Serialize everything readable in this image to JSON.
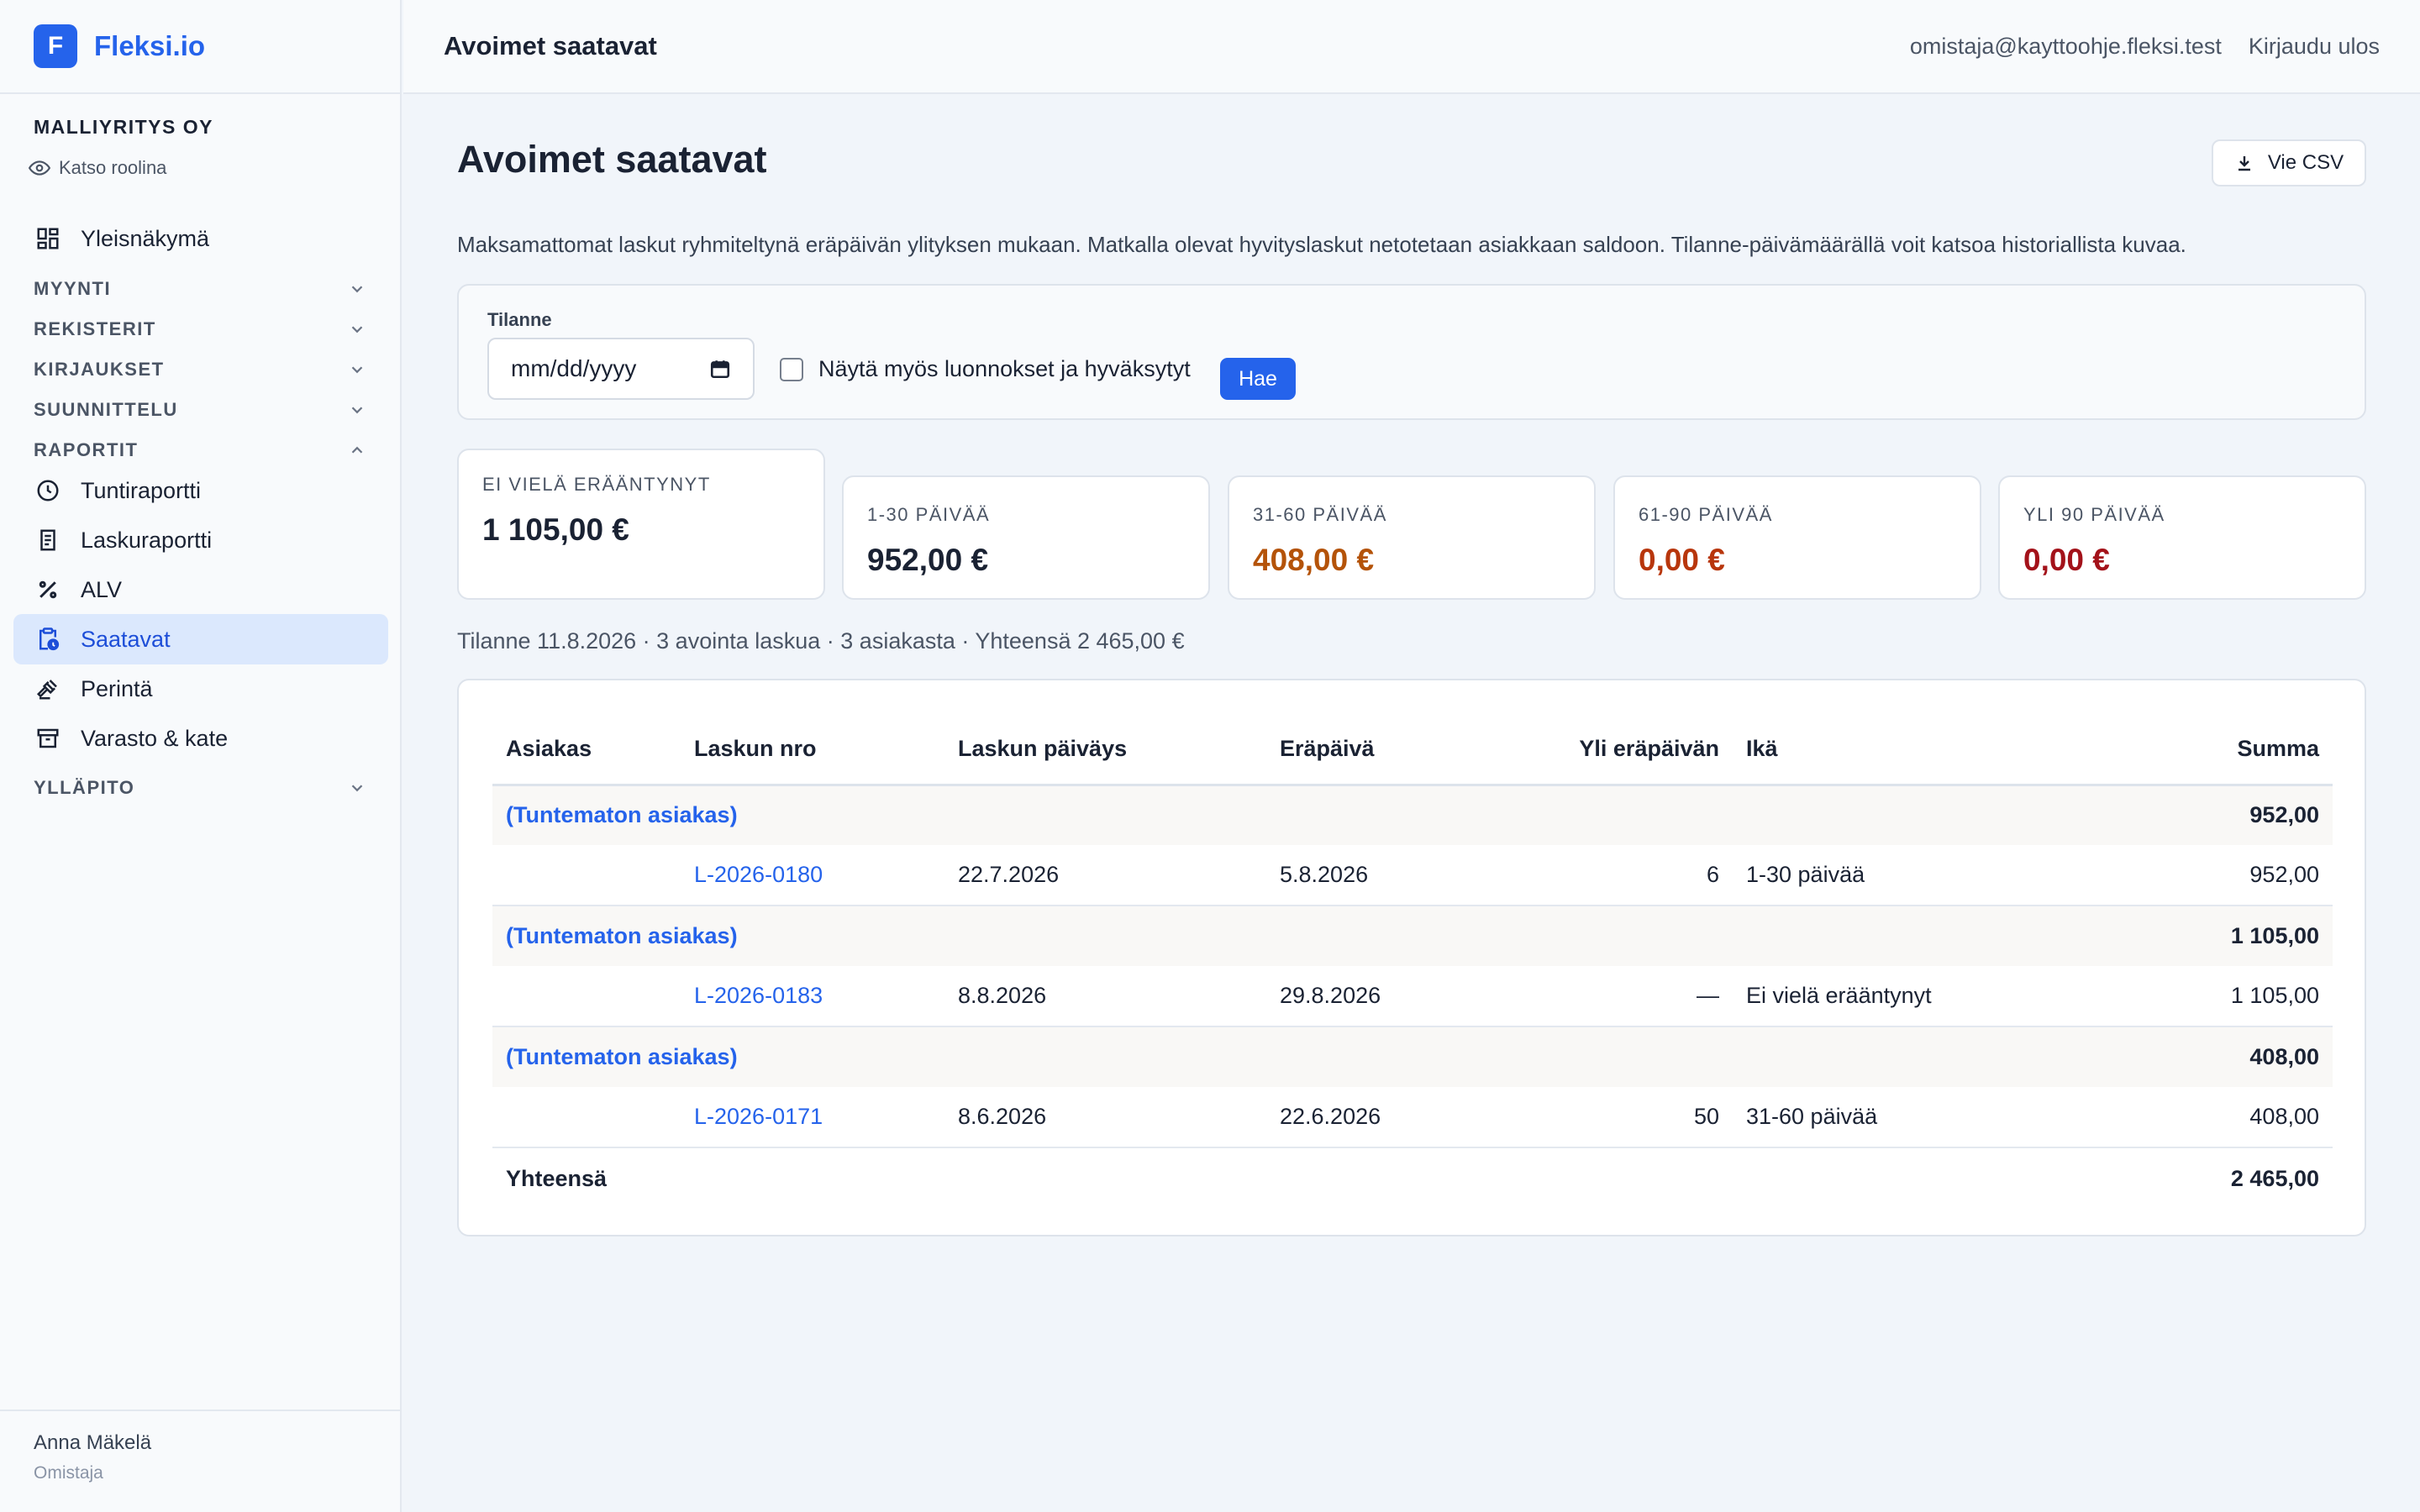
{
  "brand": {
    "logo_letter": "F",
    "name": "Fleksi.io",
    "color": "#2563eb"
  },
  "sidebar": {
    "company": "MALLIYRITYS OY",
    "view_as_role": "Katso roolina",
    "overview": "Yleisnäkymä",
    "sections": {
      "sales": "MYYNTI",
      "registers": "REKISTERIT",
      "bookkeeping": "KIRJAUKSET",
      "planning": "SUUNNITTELU",
      "reports": "RAPORTIT",
      "maintenance": "YLLÄPITO"
    },
    "report_items": [
      {
        "label": "Tuntiraportti",
        "icon": "clock-icon"
      },
      {
        "label": "Laskuraportti",
        "icon": "receipt-icon"
      },
      {
        "label": "ALV",
        "icon": "percent-icon"
      },
      {
        "label": "Saatavat",
        "icon": "clipboard-clock-icon",
        "active": true
      },
      {
        "label": "Perintä",
        "icon": "gavel-icon"
      },
      {
        "label": "Varasto & kate",
        "icon": "archive-box-icon"
      }
    ],
    "user": {
      "name": "Anna Mäkelä",
      "role": "Omistaja"
    }
  },
  "topbar": {
    "title": "Avoimet saatavat",
    "email": "omistaja@kayttoohje.fleksi.test",
    "logout": "Kirjaudu ulos"
  },
  "main": {
    "title": "Avoimet saatavat",
    "csv_button": "Vie CSV",
    "description": "Maksamattomat laskut ryhmiteltynä eräpäivän ylityksen mukaan. Matkalla olevat hyvityslaskut netotetaan asiakkaan saldoon. Tilanne-päivämäärällä voit katsoa historiallista kuvaa.",
    "filter": {
      "label": "Tilanne",
      "date_placeholder": "mm/dd/yyyy",
      "checkbox_label": "Näytä myös luonnokset ja hyväksytyt",
      "search_button": "Hae"
    },
    "summary": [
      {
        "label": "EI VIELÄ ERÄÄNTYNYT",
        "value": "1 105,00 €",
        "color": "#1a2233"
      },
      {
        "label": "1-30 PÄIVÄÄ",
        "value": "952,00 €",
        "color": "#1a2233"
      },
      {
        "label": "31-60 PÄIVÄÄ",
        "value": "408,00 €",
        "color": "#b45309"
      },
      {
        "label": "61-90 PÄIVÄÄ",
        "value": "0,00 €",
        "color": "#b8360c"
      },
      {
        "label": "YLI 90 PÄIVÄÄ",
        "value": "0,00 €",
        "color": "#a3121a"
      }
    ],
    "status_line": "Tilanne 11.8.2026 · 3 avointa laskua · 3 asiakasta · Yhteensä 2 465,00 €",
    "table": {
      "headers": [
        "Asiakas",
        "Laskun nro",
        "Laskun päiväys",
        "Eräpäivä",
        "Yli eräpäivän",
        "Ikä",
        "Summa"
      ],
      "groups": [
        {
          "customer": "(Tuntematon asiakas)",
          "total": "952,00",
          "invoice": {
            "number": "L-2026-0180",
            "date": "22.7.2026",
            "due": "5.8.2026",
            "overdue": "6",
            "age": "1-30 päivää",
            "amount": "952,00"
          }
        },
        {
          "customer": "(Tuntematon asiakas)",
          "total": "1 105,00",
          "invoice": {
            "number": "L-2026-0183",
            "date": "8.8.2026",
            "due": "29.8.2026",
            "overdue": "—",
            "age": "Ei vielä erääntynyt",
            "amount": "1 105,00"
          }
        },
        {
          "customer": "(Tuntematon asiakas)",
          "total": "408,00",
          "invoice": {
            "number": "L-2026-0171",
            "date": "8.6.2026",
            "due": "22.6.2026",
            "overdue": "50",
            "age": "31-60 päivää",
            "amount": "408,00"
          }
        }
      ],
      "total_label": "Yhteensä",
      "grand_total": "2 465,00"
    }
  }
}
